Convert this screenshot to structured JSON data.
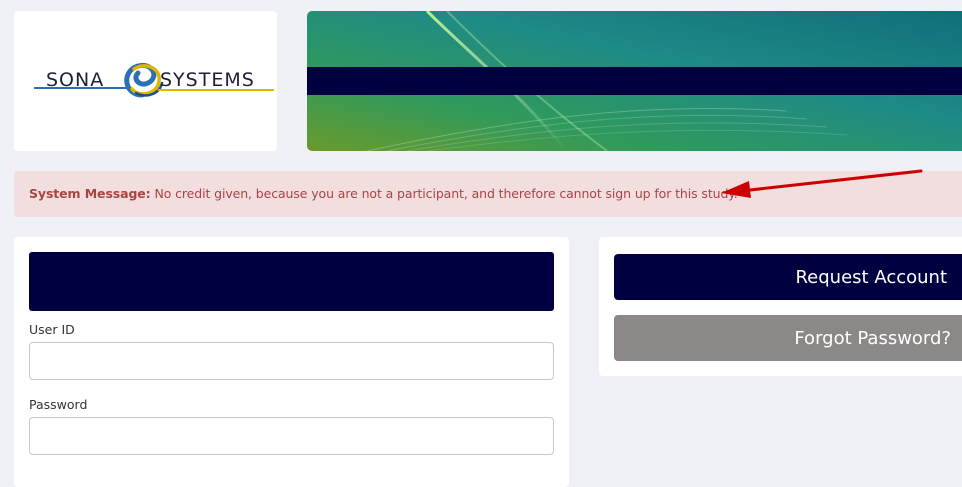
{
  "brand": {
    "logo_word_left": "SONA",
    "logo_word_right": "SYSTEMS",
    "colors": {
      "navy": "#000040",
      "gold": "#e0b400",
      "blue": "#2c6fb5"
    }
  },
  "system_message": {
    "label": "System Message:",
    "text": " No credit given, because you are not a participant, and therefore cannot sign up for this study.",
    "arrow_color": "#cc0000"
  },
  "login": {
    "user_id_label": "User ID",
    "user_id_value": "",
    "password_label": "Password",
    "password_value": ""
  },
  "account": {
    "request_label": "Request Account",
    "forgot_label": "Forgot Password?"
  }
}
